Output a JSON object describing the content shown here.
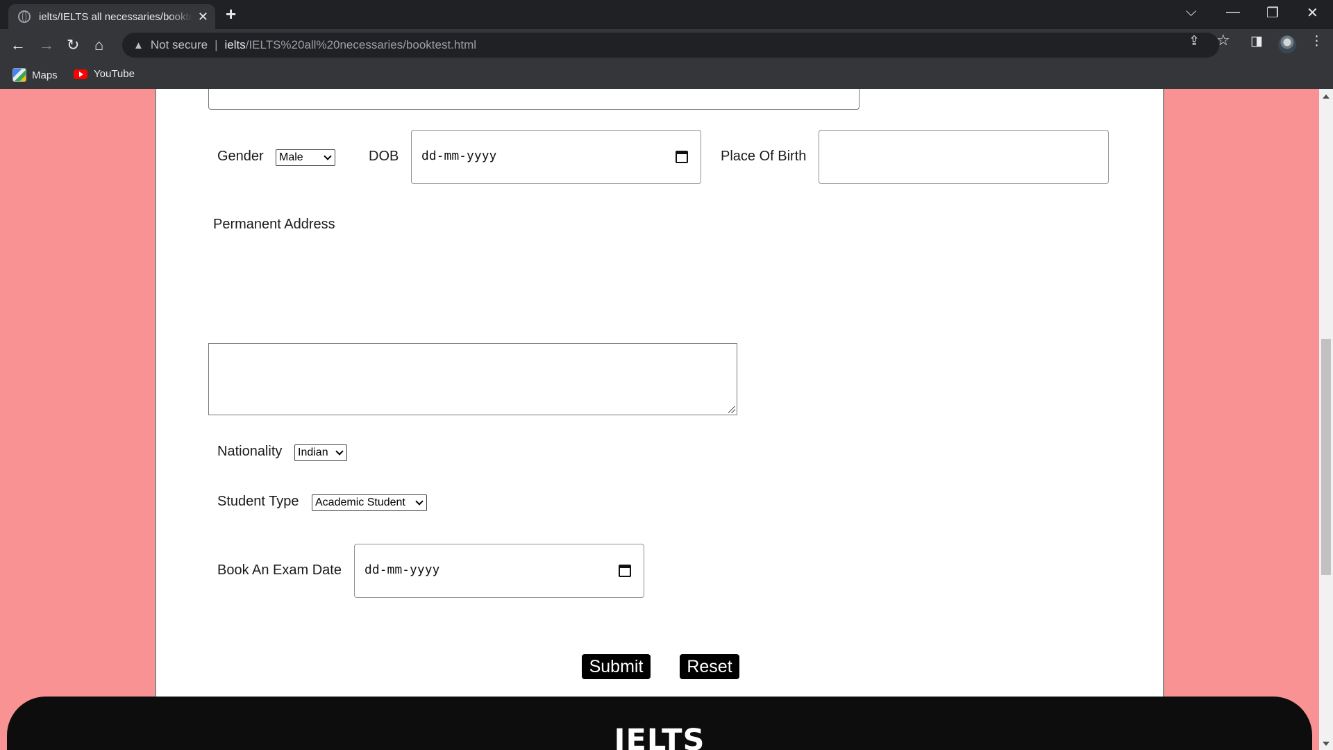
{
  "browser": {
    "tab_title": "ielts/IELTS all necessaries/booktest.html",
    "tab_close": "✕",
    "new_tab": "+",
    "window_controls": {
      "tab_search": "⌵",
      "minimize": "—",
      "restore": "❐",
      "close": "✕"
    },
    "nav": {
      "back": "←",
      "forward": "→",
      "reload": "↻",
      "home": "⌂"
    },
    "address": {
      "warning_icon": "▲",
      "security_text": "Not secure",
      "separator": "|",
      "host": "ielts",
      "path": "/IELTS%20all%20necessaries/booktest.html"
    },
    "toolbar_icons": {
      "share": "⇪",
      "bookmark_star": "☆",
      "side_panel": "◨",
      "menu": "⋮"
    },
    "bookmarks": [
      {
        "label": "Maps",
        "icon": "maps-icon"
      },
      {
        "label": "YouTube",
        "icon": "youtube-icon"
      }
    ]
  },
  "form": {
    "gender": {
      "label": "Gender",
      "selected": "Male"
    },
    "dob": {
      "label": "DOB",
      "value": "dd-mm-yyyy"
    },
    "place_of_birth": {
      "label": "Place Of Birth",
      "value": ""
    },
    "permanent_address": {
      "label": "Permanent Address",
      "value": ""
    },
    "nationality": {
      "label": "Nationality",
      "selected": "Indian"
    },
    "student_type": {
      "label": "Student Type",
      "selected": "Academic Student"
    },
    "exam_date": {
      "label": "Book An Exam Date",
      "value": "dd-mm-yyyy"
    },
    "submit_label": "Submit",
    "reset_label": "Reset"
  },
  "footer": {
    "title": "IELTS"
  },
  "colors": {
    "page_background": "#f99393",
    "footer_background": "#0d0d0d",
    "button_background": "#000000"
  }
}
